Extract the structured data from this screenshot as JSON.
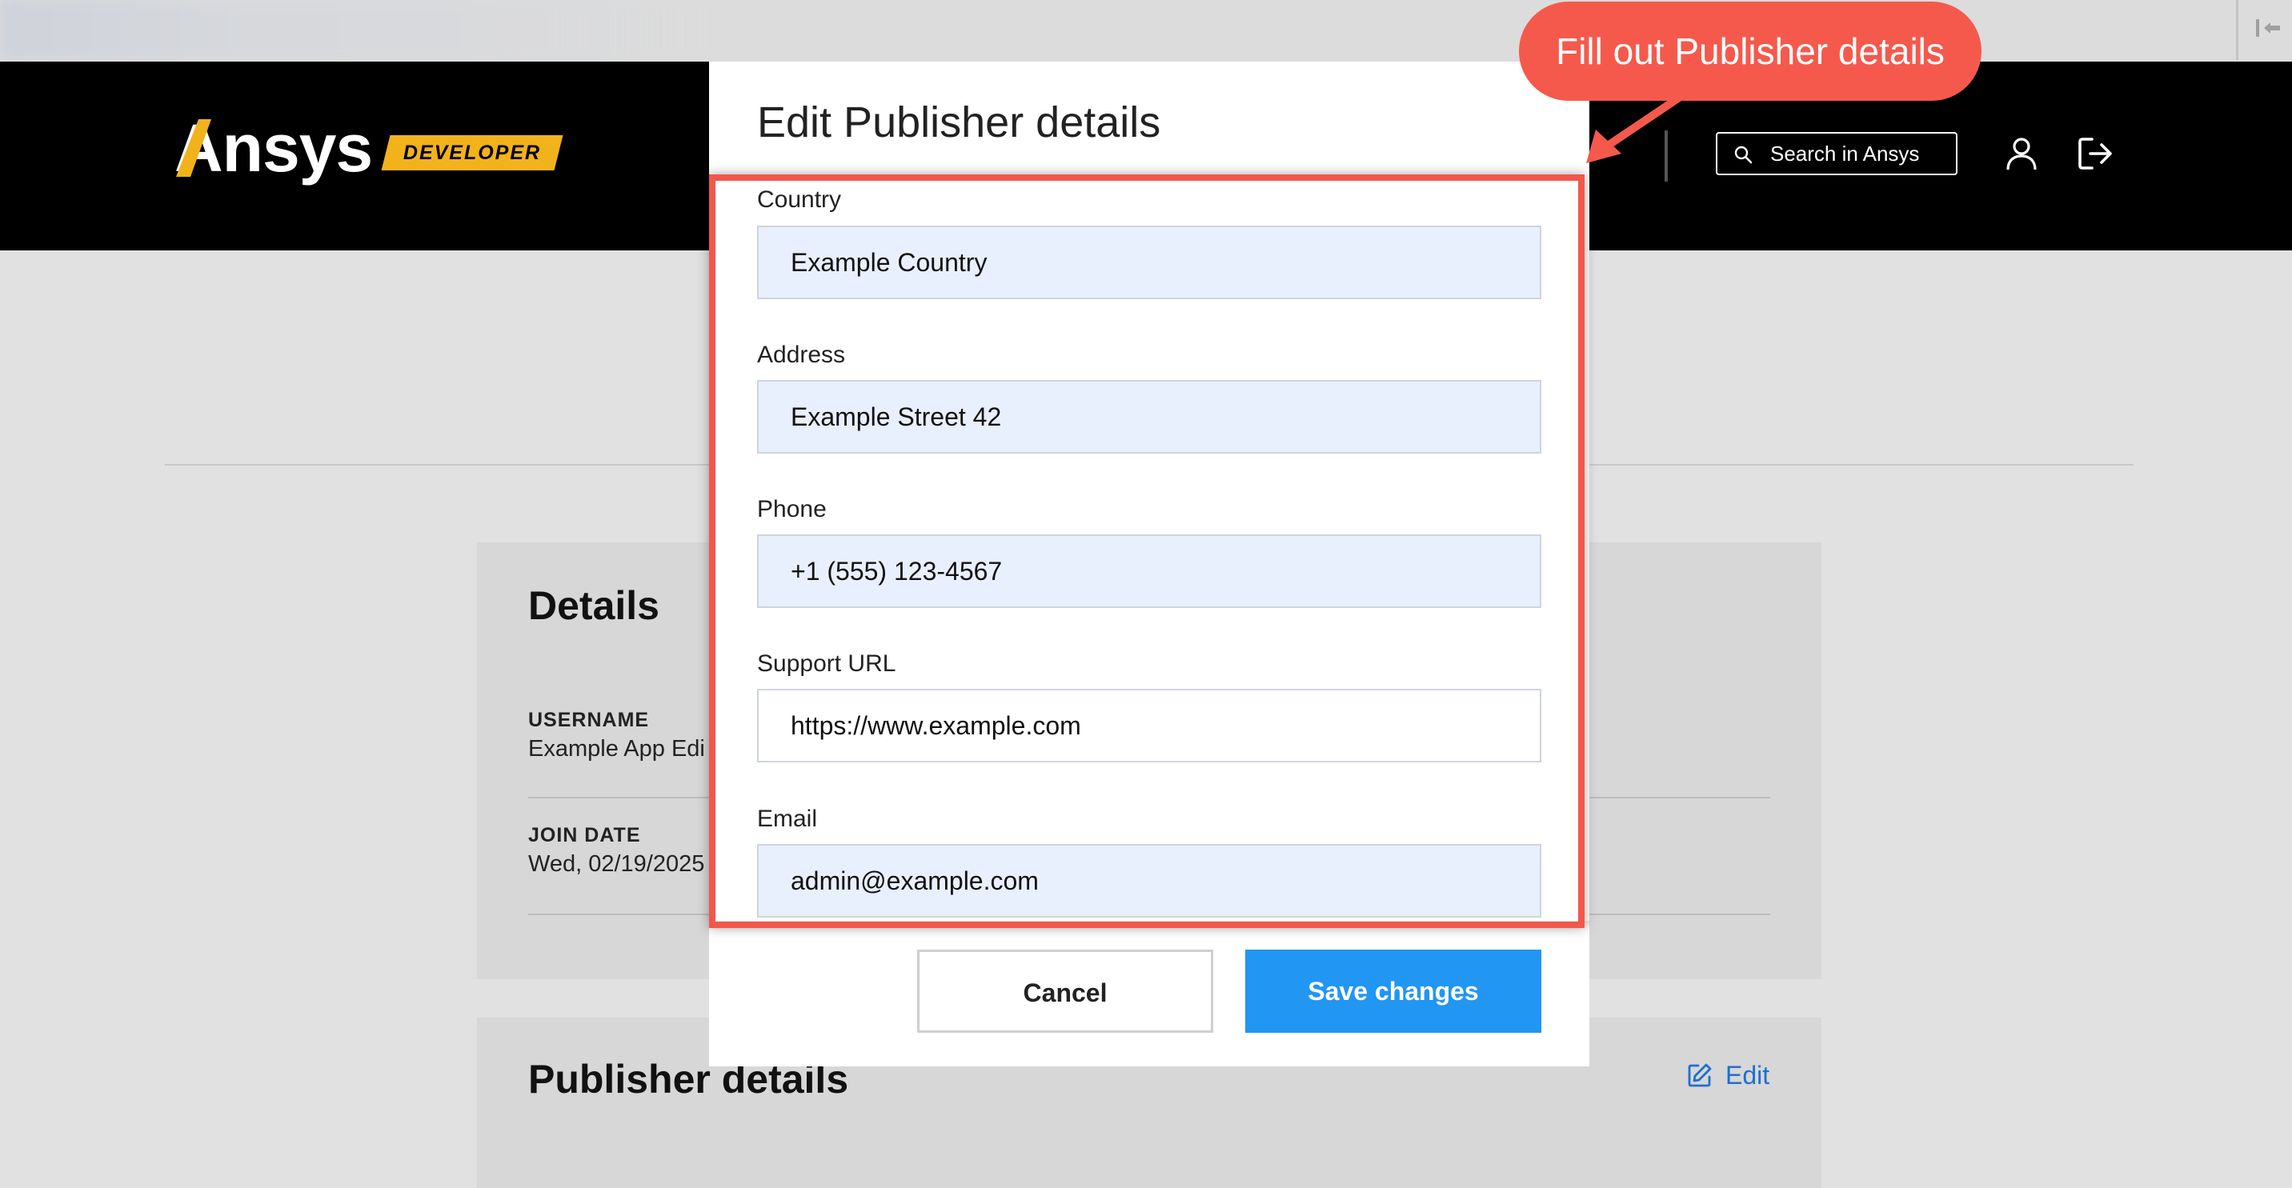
{
  "header": {
    "logo": "Ansys",
    "badge": "DEVELOPER",
    "search_label": "Search in Ansys"
  },
  "details_card": {
    "title": "Details",
    "username_label": "USERNAME",
    "username_value": "Example App Edi",
    "join_date_label": "JOIN DATE",
    "join_date_value": "Wed, 02/19/2025"
  },
  "publisher_card": {
    "title": "Publisher details",
    "edit_label": "Edit"
  },
  "modal": {
    "title": "Edit Publisher details",
    "fields": [
      {
        "label": "Country",
        "value": "Example Country"
      },
      {
        "label": "Address",
        "value": "Example Street 42"
      },
      {
        "label": "Phone",
        "value": "+1 (555) 123-4567"
      },
      {
        "label": "Support URL",
        "value": "https://www.example.com"
      },
      {
        "label": "Email",
        "value": "admin@example.com"
      }
    ],
    "cancel_label": "Cancel",
    "save_label": "Save changes"
  },
  "annotation": {
    "callout_text": "Fill out Publisher details"
  },
  "colors": {
    "accent_yellow": "#f2b21b",
    "primary_blue": "#2196f3",
    "callout_red": "#f5594c",
    "link_blue": "#1f6fd0"
  },
  "icons": [
    "collapse-sidebar-icon",
    "search-icon",
    "user-icon",
    "logout-icon",
    "edit-icon"
  ]
}
